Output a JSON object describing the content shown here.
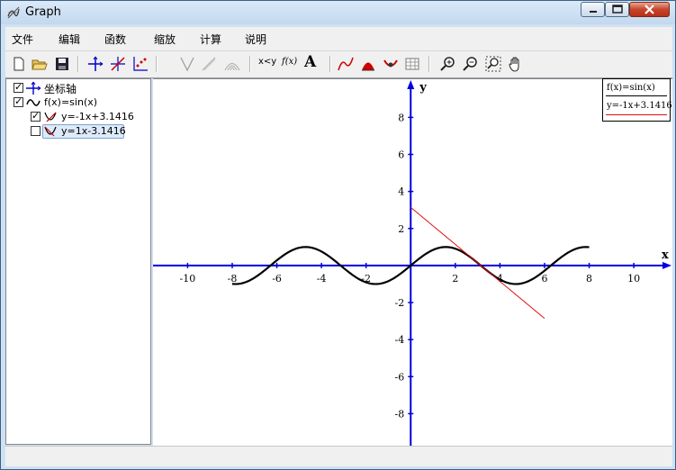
{
  "window": {
    "title": "Graph"
  },
  "menu": [
    "文件",
    "编辑",
    "函数",
    "缩放",
    "计算",
    "说明"
  ],
  "toolbar": {
    "xy_label": "x<y",
    "fx_label": "f(x)",
    "text_label": "A"
  },
  "tree": {
    "axes_label": "坐标轴",
    "func_label": "f(x)=sin(x)",
    "tangent1_label": "y=-1x+3.1416",
    "tangent2_label": "y=1x-3.1416"
  },
  "legend": {
    "func": "f(x)=sin(x)",
    "tangent": "y=-1x+3.1416"
  },
  "chart_data": {
    "type": "line",
    "xlabel": "x",
    "ylabel": "y",
    "xlim": [
      -11.55,
      11.73
    ],
    "ylim": [
      -9.73,
      10.06
    ],
    "xticks": [
      -10,
      -8,
      -6,
      -4,
      -2,
      2,
      4,
      6,
      8,
      10
    ],
    "yticks": [
      -8,
      -6,
      -4,
      -2,
      2,
      4,
      6,
      8
    ],
    "series": [
      {
        "name": "f(x)=sin(x)",
        "color": "#000000",
        "function": "sin(x)",
        "x_range": [
          -8,
          8
        ]
      },
      {
        "name": "y=-1x+3.1416",
        "color": "#e01010",
        "function": "-x+3.1416",
        "x_range": [
          0,
          6
        ]
      }
    ],
    "grid": false
  },
  "colors": {
    "axis": "#0000dd",
    "function": "#000000",
    "tangent": "#e01010"
  }
}
